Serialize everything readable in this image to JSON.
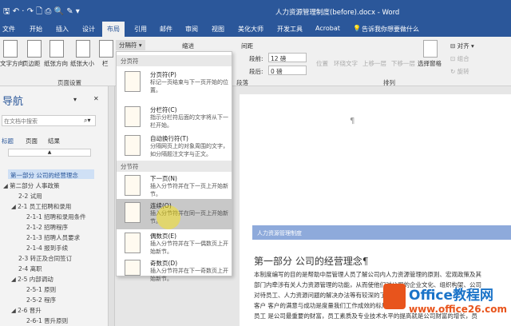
{
  "title": "人力资源管理制度(before).docx - Word",
  "tabs": [
    "文件",
    "开始",
    "插入",
    "设计",
    "布局",
    "引用",
    "邮件",
    "审阅",
    "视图",
    "美化大师",
    "开发工具",
    "Acrobat"
  ],
  "tell_me": "告诉我你想要做什么",
  "ribbon": {
    "page_setup": [
      "文字方向",
      "页边距",
      "纸张方向",
      "纸张大小",
      "栏"
    ],
    "page_setup_label": "页面设置",
    "breaks_button": "分隔符",
    "indent_label": "缩进",
    "spacing_label": "间距",
    "before_label": "段前:",
    "before_value": "12 磅",
    "after_label": "段后:",
    "after_value": "0 磅",
    "paragraph_label": "段落",
    "arrange": [
      "位置",
      "环绕文字",
      "上移一层",
      "下移一层",
      "选择窗格"
    ],
    "align": "对齐",
    "group": "组合",
    "rotate": "旋转",
    "arrange_label": "排列"
  },
  "nav": {
    "title": "导航",
    "search_placeholder": "在文档中搜索",
    "tabs": [
      "标题",
      "页面",
      "结果"
    ],
    "items": [
      "第一部分 公司的经营理念",
      "第二部分 人事政策",
      "2-2 试用",
      "2-1 员工招聘和录用",
      "2-1-1 招聘和录用条件",
      "2-1-2 招聘程序",
      "2-1-3 招聘人员要求",
      "2-1-4 报到手续",
      "2-3 转正及合同签订",
      "2-4 离职",
      "2-5 内部调动",
      "2-5-1 原则",
      "2-5-2 程序",
      "2-6 晋升",
      "2-6-1 晋升原则"
    ]
  },
  "menu": {
    "section1": "分页符",
    "section2": "分节符",
    "items": [
      {
        "title": "分页符(P)",
        "desc": "标记一页结束与下一页开始的位置。"
      },
      {
        "title": "分栏符(C)",
        "desc": "指示分栏符后面的文字将从下一栏开始。"
      },
      {
        "title": "自动换行符(T)",
        "desc": "分隔网页上的对象周围的文字，如分隔题注文字与正文。"
      },
      {
        "title": "下一页(N)",
        "desc": "插入分节符并在下一页上开始新节。"
      },
      {
        "title": "连续(O)",
        "desc": "插入分节符并在同一页上开始新节。"
      },
      {
        "title": "偶数页(E)",
        "desc": "插入分节符并在下一偶数页上开始新节。"
      },
      {
        "title": "奇数页(D)",
        "desc": "插入分节符并在下一奇数页上开始新节。"
      }
    ]
  },
  "doc": {
    "pilcrow": "¶",
    "header_text": "人力资源管理制度",
    "heading": "第一部分  公司的经营理念¶",
    "lines": [
      "本制度编写的目的是帮助中层管理人员了解公司内人力资源管理的原则、宏观政策及其",
      "部门内牵涉有关人力资源管理的功能，从而使他们对公司的企业文化、组织构架、公司",
      "对待员工、人力资源问题的解决办法等有较深的了解。",
      "客户   客户的满意与成功是度量我们工作成效的标尺¶",
      "员工   是公司最重要的财富，员工素质及专业技术水平的提高就是公司财富的增长，员"
    ]
  },
  "watermark": {
    "brand": "Office教程网",
    "url": "www.office26.com"
  }
}
